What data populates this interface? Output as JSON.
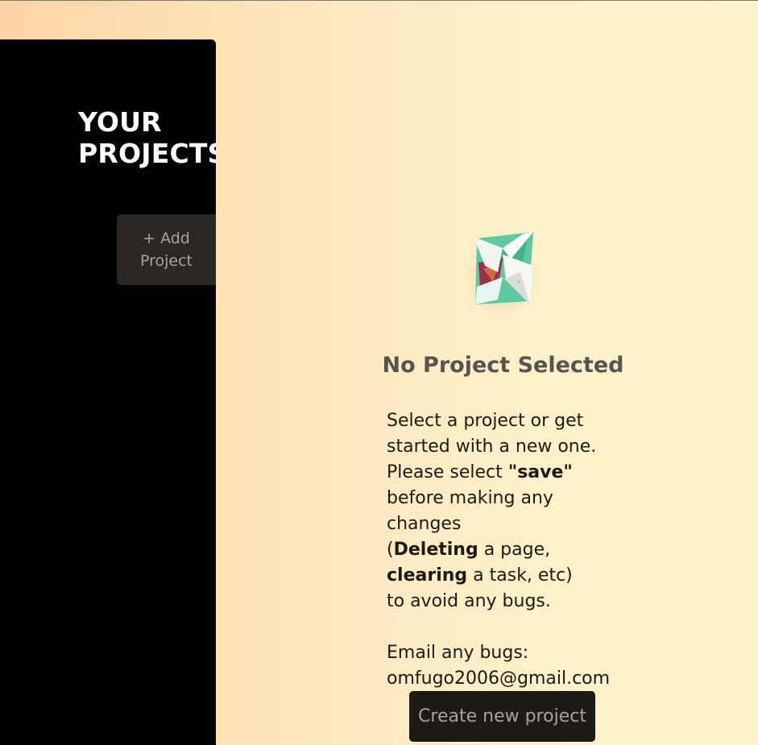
{
  "sidebar": {
    "title": "YOUR\nPROJECTS",
    "add_project_label": "+ Add\nProject"
  },
  "main": {
    "logo_icon": "origami-project-icon",
    "heading": "No Project Selected",
    "lines": {
      "l1": "Select a project or get started with a new one.",
      "l2_pre": "Please select ",
      "l2_bold": "\"save\"",
      "l2_post": " before making any changes",
      "l3_open": "(",
      "l3_bold1": "Deleting",
      "l3_mid": " a page, ",
      "l3_bold2": "clearing",
      "l3_post": " a task, etc)",
      "l4": "to avoid any bugs.",
      "email_label": "Email any bugs:",
      "email": "omfugo2006@gmail.com"
    },
    "create_button_label": "Create new project"
  },
  "colors": {
    "sidebar_bg": "#000000",
    "button_dark": "#1c1917",
    "gradient_start": "#fdd5a6",
    "gradient_end": "#fdf3cb"
  }
}
